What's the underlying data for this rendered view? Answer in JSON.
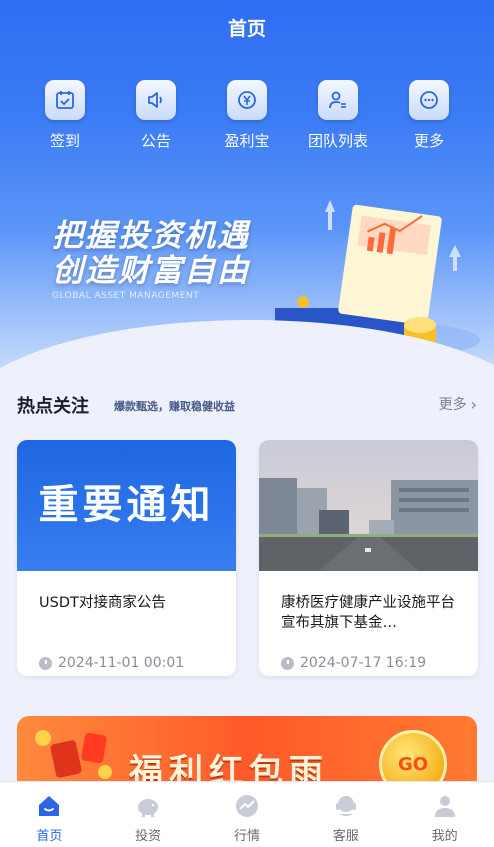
{
  "header": {
    "title": "首页"
  },
  "quick_nav": [
    {
      "label": "签到",
      "icon": "calendar-check-icon"
    },
    {
      "label": "公告",
      "icon": "speaker-icon"
    },
    {
      "label": "盈利宝",
      "icon": "yen-coin-icon"
    },
    {
      "label": "团队列表",
      "icon": "user-list-icon"
    },
    {
      "label": "更多",
      "icon": "more-dots-icon"
    }
  ],
  "hero": {
    "slogan_line1": "把握投资机遇",
    "slogan_line2": "创造财富自由",
    "slogan_sub": "GLOBAL ASSET MANAGEMENT"
  },
  "hot": {
    "title": "热点关注",
    "subtitle": "爆款甄选，赚取稳健收益",
    "more": "更多",
    "cards": [
      {
        "image_text": "重要通知",
        "title": "USDT对接商家公告",
        "time": "2024-11-01 00:01"
      },
      {
        "title": "康桥医疗健康产业设施平台宣布其旗下基金…",
        "time": "2024-07-17 16:19"
      }
    ]
  },
  "banner": {
    "text": "福利红包雨",
    "go": "GO"
  },
  "tabbar": [
    {
      "label": "首页",
      "icon": "home-icon",
      "active": true
    },
    {
      "label": "投资",
      "icon": "piggy-bank-icon",
      "active": false
    },
    {
      "label": "行情",
      "icon": "trend-icon",
      "active": false
    },
    {
      "label": "客服",
      "icon": "support-icon",
      "active": false
    },
    {
      "label": "我的",
      "icon": "profile-icon",
      "active": false
    }
  ],
  "colors": {
    "primary": "#2b66e8",
    "hero_top": "#2f6ef2",
    "banner": "#ff5a2a"
  }
}
